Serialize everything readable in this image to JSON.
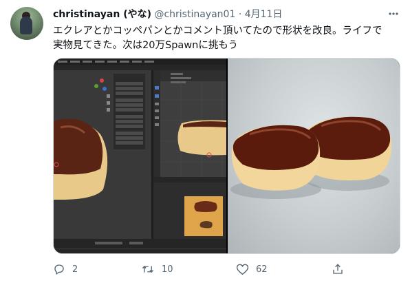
{
  "tweet": {
    "author_name": "christinayan (やな)",
    "handle": "@christinayan01",
    "separator": "·",
    "date": "4月11日",
    "text_line1": "エクレアとかコッペパンとかコメント頂いてたので形状を改良。ライフで",
    "text_line2": "実物見てきた。次は20万Spawnに挑もう"
  },
  "actions": {
    "replies": "2",
    "retweets": "10",
    "likes": "62"
  },
  "icons": {
    "more": "more-icon",
    "reply": "reply-icon",
    "retweet": "retweet-icon",
    "like": "like-icon",
    "share": "share-icon"
  },
  "colors": {
    "text": "#0f1419",
    "secondary": "#536471",
    "border": "#cfd9de",
    "blender_bg": "#2f2f2f",
    "bun_cream": "#f1d59a",
    "bun_glaze": "#5a1e10"
  }
}
